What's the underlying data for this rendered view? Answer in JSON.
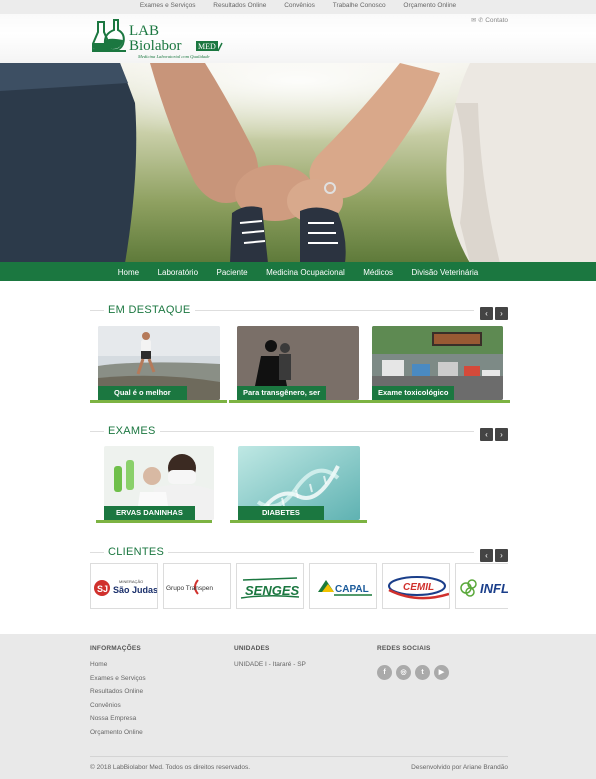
{
  "top_links": [
    "Exames e Serviços",
    "Resultados Online",
    "Convênios",
    "Trabalhe Conosco",
    "Orçamento Online"
  ],
  "logo": {
    "line1": "LAB",
    "line2": "Biolabor",
    "tag": "MED",
    "tagline": "Medicina Laboratorial com Qualidade"
  },
  "contact_label": "Contato",
  "nav": [
    "Home",
    "Laboratório",
    "Paciente",
    "Medicina Ocupacional",
    "Médicos",
    "Divisão Veterinária"
  ],
  "destaque": {
    "title": "EM DESTAQUE",
    "cards": [
      "Qual é o melhor",
      "Para transgênero, ser",
      "Exame toxicológico"
    ]
  },
  "exames": {
    "title": "EXAMES",
    "cards": [
      "ERVAS DANINHAS",
      "DIABETES"
    ]
  },
  "clientes": {
    "title": "CLIENTES",
    "logos": [
      "Mineração São Judas",
      "Grupo Transpen",
      "SENGES",
      "CAPAL",
      "CEMIL",
      "INFLO"
    ],
    "logo_texts": {
      "saojudas_top": "MINERAÇÃO",
      "saojudas_main": "São Judas",
      "transpen": "Grupo Transpen",
      "senges": "SENGES",
      "capal": "CAPAL",
      "cemil": "CEMIL",
      "inflo": "INFL"
    }
  },
  "footer": {
    "info_title": "INFORMAÇÕES",
    "info_links": [
      "Home",
      "Exames e Serviços",
      "Resultados Online",
      "Convênios",
      "Nossa Empresa",
      "Orçamento Online"
    ],
    "units_title": "UNIDADES",
    "unit": "UNIDADE I - Itararé - SP",
    "social_title": "REDES SOCIAIS",
    "social_icons": [
      "f",
      "◎",
      "t",
      "▶"
    ],
    "copyright": "© 2018 LabBiolabor Med. Todos os direitos reservados.",
    "developer": "Desenvolvido por Ariane Brandão"
  },
  "colors": {
    "brand_green": "#1b7740",
    "accent_green": "#7cb342",
    "footer_bg": "#e9e9e9"
  }
}
